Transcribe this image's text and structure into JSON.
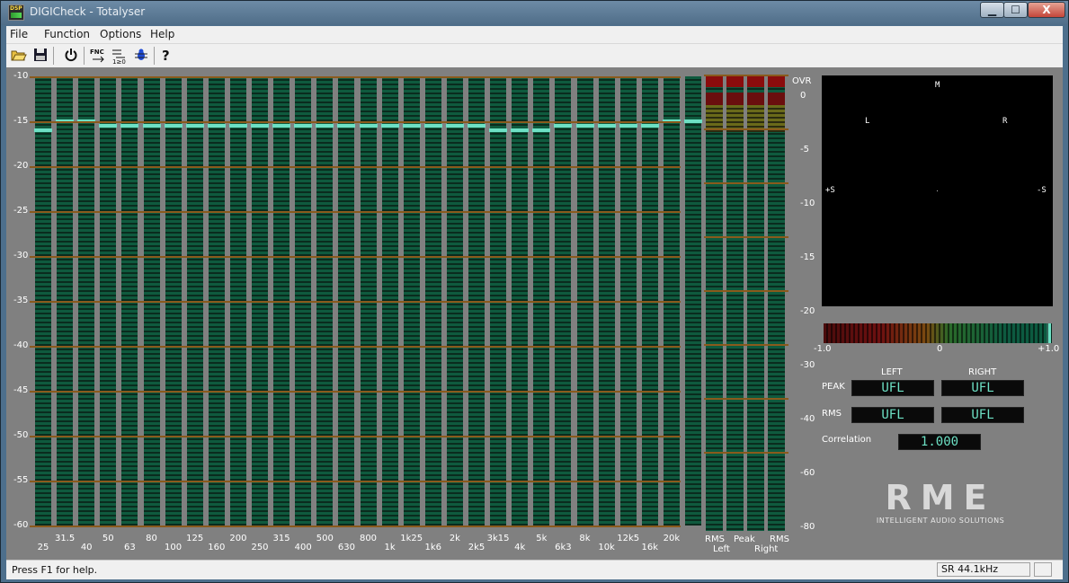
{
  "window": {
    "title": "DIGICheck - Totalyser",
    "icon_text": "DSP"
  },
  "window_controls": {
    "minimize": "▁",
    "maximize": "☐",
    "close": "X"
  },
  "menu": [
    "File",
    "Function",
    "Options",
    "Help"
  ],
  "toolbar": {
    "icons": [
      "open-icon",
      "save-icon",
      "power-icon",
      "fnc-icon",
      "sort-icon",
      "bug-icon",
      "help-icon"
    ],
    "fnc_label": "FNC"
  },
  "spectrum": {
    "y_ticks": [
      "-10",
      "-15",
      "-20",
      "-25",
      "-30",
      "-35",
      "-40",
      "-45",
      "-50",
      "-55",
      "-60"
    ],
    "bands_top": [
      "31.5",
      "50",
      "80",
      "125",
      "200",
      "315",
      "500",
      "800",
      "1k25",
      "2k",
      "3k15",
      "5k",
      "8k",
      "12k5",
      "20k"
    ],
    "bands_bottom": [
      "25",
      "40",
      "63",
      "100",
      "160",
      "250",
      "400",
      "630",
      "1k",
      "1k6",
      "2k5",
      "4k",
      "6k3",
      "10k",
      "16k"
    ],
    "levels_db": [
      -16,
      -15,
      -15,
      -15.5,
      -15.5,
      -15.5,
      -15.5,
      -15.5,
      -15.5,
      -15.5,
      -15.5,
      -15.5,
      -15.5,
      -15.5,
      -15.5,
      -15.5,
      -15.5,
      -15.5,
      -15.5,
      -15.5,
      -15.5,
      -16,
      -16,
      -16,
      -15.5,
      -15.5,
      -15.5,
      -15.5,
      -15.5,
      -15,
      -15
    ],
    "ymin": -60,
    "ymax": -10
  },
  "level_meters": {
    "scale": [
      "OVR",
      "0",
      "-5",
      "-10",
      "-15",
      "-20",
      "-30",
      "-40",
      "-60",
      "-80"
    ],
    "columns": [
      "RMS",
      "Peak",
      "Peak",
      "RMS"
    ],
    "groups": [
      "Left",
      "Right"
    ]
  },
  "goniometer": {
    "labels": {
      "m": "M",
      "l": "L",
      "r": "R",
      "plus_s": "+S",
      "minus_s": "-S"
    }
  },
  "correlation_meter": {
    "labels": [
      "-1.0",
      "0",
      "+1.0"
    ],
    "value": 1.0
  },
  "readouts": {
    "col_left": "LEFT",
    "col_right": "RIGHT",
    "peak_label": "PEAK",
    "rms_label": "RMS",
    "peak_left": "UFL",
    "peak_right": "UFL",
    "rms_left": "UFL",
    "rms_right": "UFL",
    "correlation_label": "Correlation",
    "correlation_value": "1.000"
  },
  "logo": {
    "text": "RME",
    "tagline": "INTELLIGENT AUDIO SOLUTIONS"
  },
  "status": {
    "help": "Press F1 for help.",
    "sample_rate": "SR 44.1kHz"
  },
  "colors": {
    "accent": "#6de0c4",
    "bar": "#0f5a3e",
    "grid": "#8a5a1c"
  }
}
